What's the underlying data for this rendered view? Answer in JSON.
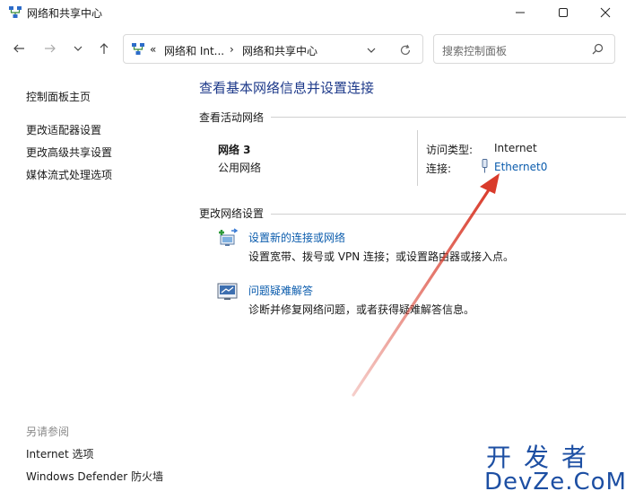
{
  "window": {
    "title": "网络和共享中心"
  },
  "address": {
    "chevrons": "«",
    "crumb1": "网络和 Int...",
    "sep": "›",
    "crumb2": "网络和共享中心"
  },
  "search": {
    "placeholder": "搜索控制面板"
  },
  "left_nav": {
    "home": "控制面板主页",
    "adapter": "更改适配器设置",
    "advanced": "更改高级共享设置",
    "media": "媒体流式处理选项"
  },
  "see_also": {
    "title": "另请参阅",
    "internet_options": "Internet 选项",
    "firewall": "Windows Defender 防火墙"
  },
  "main": {
    "title": "查看基本网络信息并设置连接",
    "active_header": "查看活动网络",
    "network_name": "网络 3",
    "network_type": "公用网络",
    "access_label": "访问类型:",
    "access_value": "Internet",
    "conn_label": "连接:",
    "conn_value": "Ethernet0",
    "change_header": "更改网络设置",
    "task1_title": "设置新的连接或网络",
    "task1_desc": "设置宽带、拨号或 VPN 连接；或设置路由器或接入点。",
    "task2_title": "问题疑难解答",
    "task2_desc": "诊断并修复网络问题，或者获得疑难解答信息。"
  },
  "watermark": {
    "line1": "开发者",
    "line2": "DevZe.CoM"
  },
  "colors": {
    "link": "#0b5cad",
    "title": "#1e3a8a",
    "arrow": "#d93b2b",
    "watermark": "#1d4fa3"
  }
}
